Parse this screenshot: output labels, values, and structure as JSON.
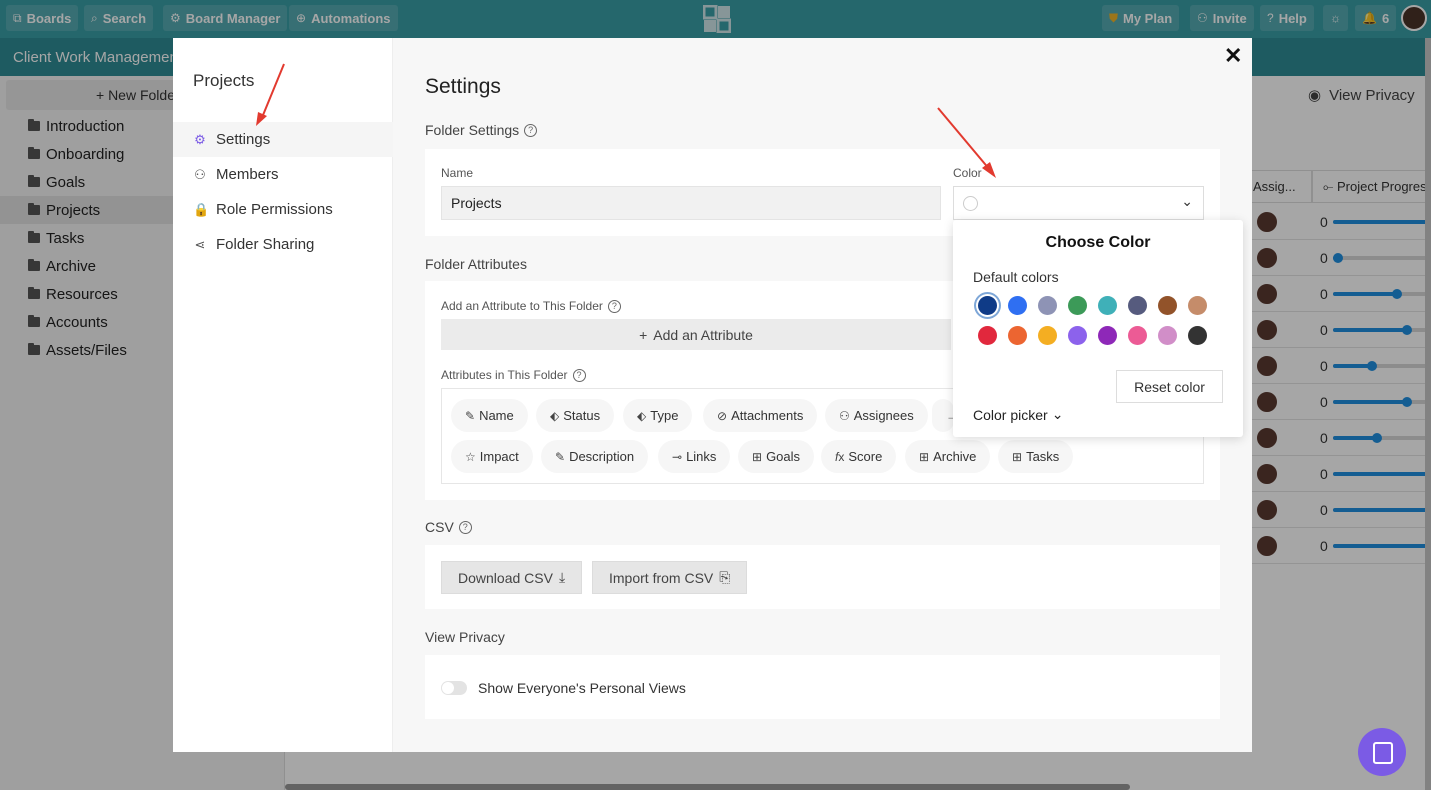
{
  "topbar": {
    "boards": "Boards",
    "search": "Search",
    "board_manager": "Board Manager",
    "automations": "Automations",
    "my_plan": "My Plan",
    "invite": "Invite",
    "help": "Help",
    "notifications_count": "6",
    "accent": "#3a9ea6"
  },
  "subbar": {
    "title": "Client Work Management"
  },
  "sidebar": {
    "new_folder": "+ New Folder",
    "folders": [
      "Introduction",
      "Onboarding",
      "Goals",
      "Projects",
      "Tasks",
      "Archive",
      "Resources",
      "Accounts",
      "Assets/Files"
    ],
    "selected": "Projects"
  },
  "board": {
    "view_privacy": "View Privacy",
    "col_assignees": "Assig...",
    "col_progress": "Project Progress",
    "rows": [
      {
        "num": "0",
        "progress": 1.0
      },
      {
        "num": "0",
        "progress": 0.05
      },
      {
        "num": "0",
        "progress": 0.65
      },
      {
        "num": "0",
        "progress": 0.75
      },
      {
        "num": "0",
        "progress": 0.4
      },
      {
        "num": "0",
        "progress": 0.75
      },
      {
        "num": "0",
        "progress": 0.45
      },
      {
        "num": "0",
        "progress": 1.0
      },
      {
        "num": "0",
        "progress": 1.0
      },
      {
        "num": "0",
        "progress": 1.0
      }
    ]
  },
  "modal": {
    "nav_title": "Projects",
    "nav_items": [
      "Settings",
      "Members",
      "Role Permissions",
      "Folder Sharing"
    ],
    "settings_heading": "Settings",
    "folder_settings": "Folder Settings",
    "name_label": "Name",
    "name_value": "Projects",
    "color_label": "Color",
    "folder_attributes": "Folder Attributes",
    "add_attr_label": "Add an Attribute to This Folder",
    "add_attr_button": "Add an Attribute",
    "attrs_in_folder_label": "Attributes in This Folder",
    "attributes_row1": [
      "Name",
      "Status",
      "Type",
      "Attachments",
      "Assignees"
    ],
    "attributes_row2": [
      "Impact",
      "Description",
      "Links",
      "Goals",
      "Score",
      "Archive",
      "Tasks"
    ],
    "csv_heading": "CSV",
    "download_csv": "Download CSV",
    "import_csv": "Import from CSV",
    "view_privacy_heading": "View Privacy",
    "show_personal_views": "Show Everyone's Personal Views"
  },
  "color_popover": {
    "title": "Choose Color",
    "subtitle": "Default colors",
    "colors": [
      "#0f3b87",
      "#2f6ff2",
      "#8e93b5",
      "#3c9a58",
      "#3fb0b8",
      "#565b7e",
      "#92532a",
      "#c58c6a",
      "#e1283d",
      "#ec6531",
      "#f4ae22",
      "#8c62ec",
      "#8e28b8",
      "#ec5b95",
      "#d18ec8",
      "#333333"
    ],
    "selected_index": 0,
    "reset": "Reset color",
    "picker": "Color picker"
  }
}
